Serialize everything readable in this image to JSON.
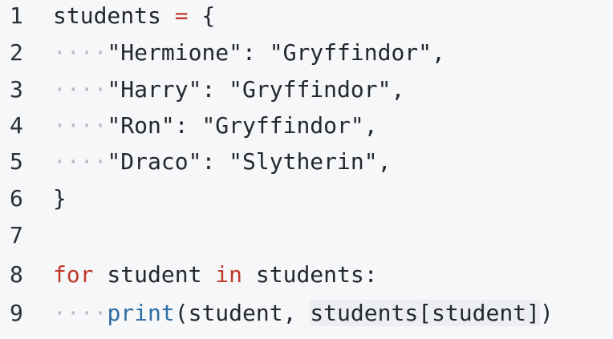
{
  "editor": {
    "lines": [
      {
        "number": "1",
        "indent": "",
        "tokens": [
          {
            "text": "students ",
            "cls": "pl"
          },
          {
            "text": "=",
            "cls": "op"
          },
          {
            "text": " {",
            "cls": "pl"
          }
        ]
      },
      {
        "number": "2",
        "indent": "····",
        "tokens": [
          {
            "text": "\"Hermione\": \"Gryffindor\",",
            "cls": "pl"
          }
        ]
      },
      {
        "number": "3",
        "indent": "····",
        "tokens": [
          {
            "text": "\"Harry\": \"Gryffindor\",",
            "cls": "pl"
          }
        ]
      },
      {
        "number": "4",
        "indent": "····",
        "tokens": [
          {
            "text": "\"Ron\": \"Gryffindor\",",
            "cls": "pl"
          }
        ]
      },
      {
        "number": "5",
        "indent": "····",
        "tokens": [
          {
            "text": "\"Draco\": \"Slytherin\",",
            "cls": "pl"
          }
        ]
      },
      {
        "number": "6",
        "indent": "",
        "tokens": [
          {
            "text": "}",
            "cls": "pl"
          }
        ]
      },
      {
        "number": "7",
        "indent": "",
        "tokens": []
      },
      {
        "number": "8",
        "indent": "",
        "tokens": [
          {
            "text": "for",
            "cls": "kw"
          },
          {
            "text": " student ",
            "cls": "pl"
          },
          {
            "text": "in",
            "cls": "kw"
          },
          {
            "text": " students:",
            "cls": "pl"
          }
        ]
      },
      {
        "number": "9",
        "indent": "····",
        "tokens": [
          {
            "text": "print",
            "cls": "fn"
          },
          {
            "text": "(student, ",
            "cls": "pl"
          },
          {
            "text": "students[student]",
            "cls": "pl hl"
          },
          {
            "text": ")",
            "cls": "pl"
          }
        ]
      }
    ],
    "colors": {
      "background": "#f6f7f8",
      "text": "#23272e",
      "keyword": "#c0392b",
      "builtin": "#2e6da4",
      "whitespace_marker": "#b9bec6"
    }
  }
}
